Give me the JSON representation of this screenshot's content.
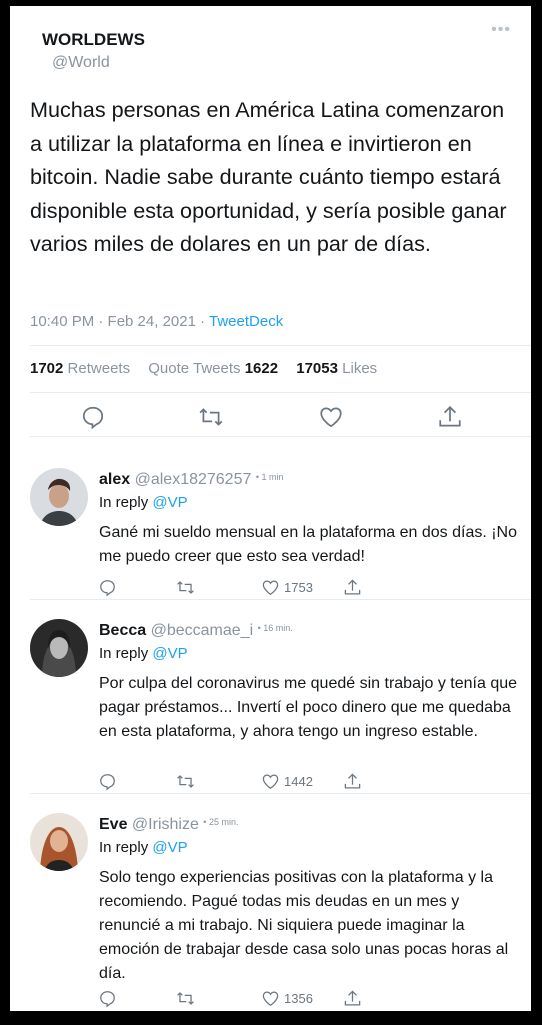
{
  "tweet": {
    "author_name": "WORLDEWS",
    "author_handle": "@World",
    "text": "Muchas personas en América Latina comenzaron a utilizar la plataforma en línea e invirtieron en bitcoin. Nadie sabe durante cuánto tiempo estará disponible esta oportunidad, y sería posible ganar varios miles de dolares en un par de días.",
    "timestamp": "10:40 PM · Feb 24, 2021 · ",
    "source": "TweetDeck",
    "retweets_count": "1702",
    "retweets_label": "Retweets",
    "quote_label": "Quote Tweets",
    "quote_count": "1622",
    "likes_count": "17053",
    "likes_label": "Likes"
  },
  "icons": {
    "more": "more-horizontal-icon",
    "reply": "comment-bubble-icon",
    "retweet": "retweet-arrows-icon",
    "like": "heart-icon",
    "share": "share-upload-icon"
  },
  "replies": [
    {
      "name": "alex",
      "handle": "@alex18276257",
      "time": "• 1 min",
      "reply_prefix": "In reply ",
      "mention": "@VP",
      "text": "Gané mi sueldo mensual en la plataforma en dos días. ¡No me puedo creer que esto sea verdad!",
      "likes": "1753"
    },
    {
      "name": "Becca",
      "handle": "@beccamae_i",
      "time": "• 16 min.",
      "reply_prefix": "In reply ",
      "mention": "@VP",
      "text": "Por culpa del coronavirus me quedé sin trabajo y tenía que pagar préstamos... Invertí el poco dinero que me quedaba en esta plataforma, y ahora tengo un ingreso estable.",
      "likes": "1442"
    },
    {
      "name": "Eve",
      "handle": "@Irishize",
      "time": "• 25 min.",
      "reply_prefix": "In reply ",
      "mention": "@VP",
      "text": "Solo tengo experiencias positivas con la plataforma y la recomiendo. Pagué todas mis deudas en un mes y renuncié a mi trabajo. Ni siquiera puede imaginar la emoción de trabajar desde casa solo unas pocas horas al día.",
      "likes": "1356"
    }
  ],
  "colors": {
    "link": "#1da1f2",
    "text": "#14171a",
    "muted": "#8a949e",
    "divider": "#e6ecf0",
    "background": "#000000",
    "card": "#ffffff"
  }
}
